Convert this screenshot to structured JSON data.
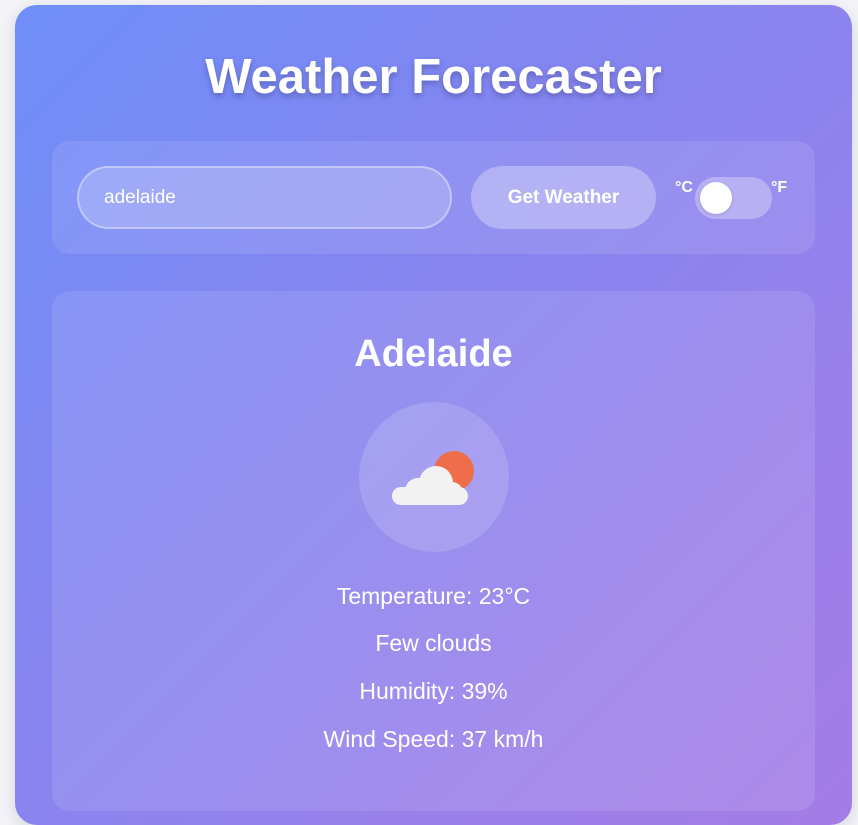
{
  "app": {
    "title": "Weather Forecaster"
  },
  "search": {
    "value": "adelaide",
    "button_label": "Get Weather"
  },
  "units": {
    "celsius_label": "°C",
    "fahrenheit_label": "°F",
    "selected": "celsius"
  },
  "weather": {
    "city": "Adelaide",
    "icon": "few-clouds-icon",
    "temperature": "Temperature: 23°C",
    "description": "Few clouds",
    "humidity": "Humidity: 39%",
    "wind_speed": "Wind Speed: 37 km/h"
  },
  "colors": {
    "sun": "#ee6e4a",
    "cloud": "#f2f2f2",
    "gradient_start": "#6e8ef9",
    "gradient_end": "#a57ce6"
  }
}
